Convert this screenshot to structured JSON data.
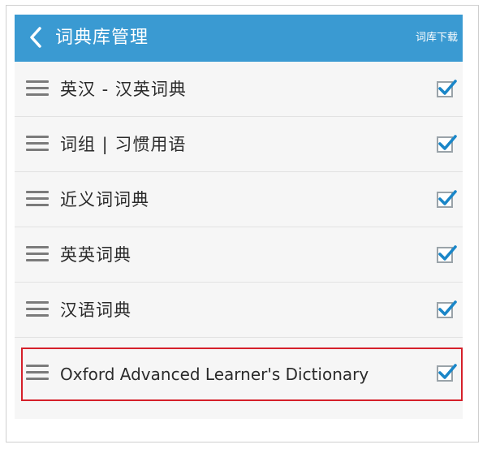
{
  "header": {
    "title": "词典库管理",
    "action_label": "词库下载"
  },
  "dictionaries": [
    {
      "label": "英汉 - 汉英词典",
      "checked": true
    },
    {
      "label": "词组 | 习惯用语",
      "checked": true
    },
    {
      "label": "近义词词典",
      "checked": true
    },
    {
      "label": "英英词典",
      "checked": true
    },
    {
      "label": "汉语词典",
      "checked": true
    },
    {
      "label": "Oxford Advanced Learner's Dictionary",
      "checked": true
    }
  ],
  "colors": {
    "appbar": "#3a9ad2",
    "check": "#1a86c8",
    "highlight": "#d5202a"
  },
  "icons": {
    "back": "chevron-left-icon",
    "handle": "drag-handle-icon",
    "check": "checkbox-checked-icon"
  }
}
